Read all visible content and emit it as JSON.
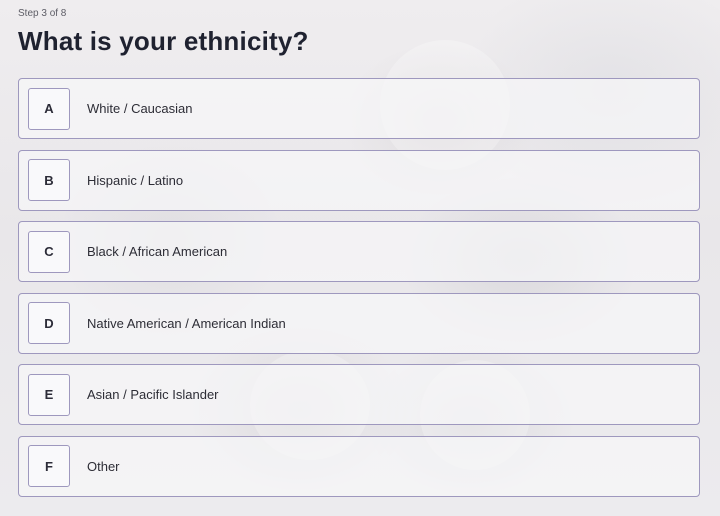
{
  "header": {
    "step": "Step 3 of 8",
    "question": "What is your ethnicity?"
  },
  "options": [
    {
      "letter": "A",
      "label": "White / Caucasian"
    },
    {
      "letter": "B",
      "label": "Hispanic / Latino"
    },
    {
      "letter": "C",
      "label": "Black / African American"
    },
    {
      "letter": "D",
      "label": "Native American / American Indian"
    },
    {
      "letter": "E",
      "label": "Asian / Pacific Islander"
    },
    {
      "letter": "F",
      "label": "Other"
    }
  ],
  "colors": {
    "option_border": "#9e98be",
    "title_text": "#1f2230"
  }
}
